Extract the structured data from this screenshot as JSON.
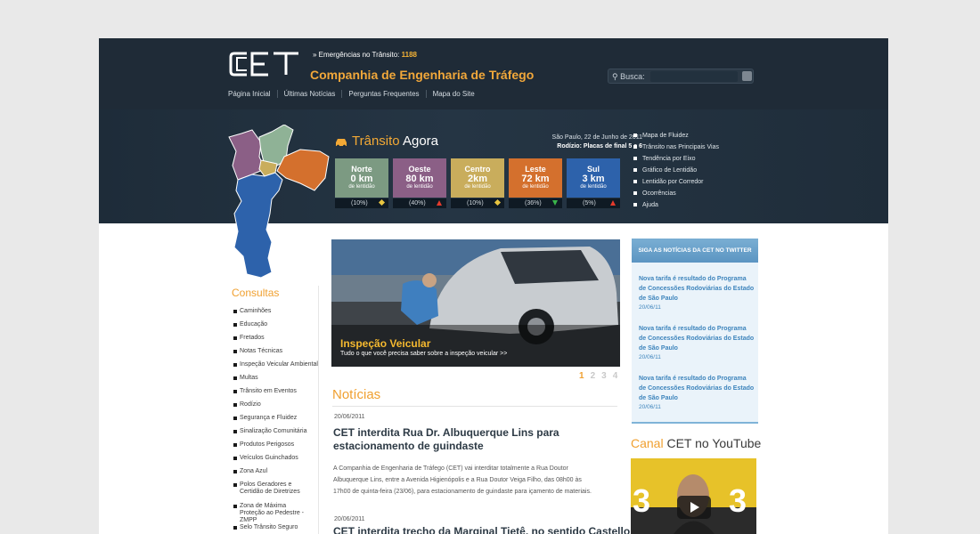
{
  "header": {
    "logo_text": "CET",
    "emergency_label": "Emergências no Trânsito:",
    "emergency_number": "1188",
    "company_name": "Companhia de Engenharia de Tráfego",
    "nav": [
      "Página Inicial",
      "Últimas Notícias",
      "Perguntas Frequentes",
      "Mapa do Site"
    ],
    "search_label": "Busca:",
    "search_value": ""
  },
  "traffic": {
    "title_part1": "Trânsito",
    "title_part2": "Agora",
    "date": "São Paulo, 22 de Junho de 2011",
    "rodizio": "Rodízio: Placas de final 5 e 6",
    "zones": [
      {
        "name": "Norte",
        "km": "0 km",
        "sub": "de lentidão",
        "pct": "(10%)",
        "trend": "stable",
        "color": "#7c9a82"
      },
      {
        "name": "Oeste",
        "km": "80 km",
        "sub": "de lentidão",
        "pct": "(40%)",
        "trend": "up",
        "color": "#8b5f86"
      },
      {
        "name": "Centro",
        "km": "2km",
        "sub": "de lentidão",
        "pct": "(10%)",
        "trend": "stable",
        "color": "#c9ad5c"
      },
      {
        "name": "Leste",
        "km": "72 km",
        "sub": "de lentidão",
        "pct": "(36%)",
        "trend": "down",
        "color": "#d4702d"
      },
      {
        "name": "Sul",
        "km": "3 km",
        "sub": "de lentidão",
        "pct": "(5%)",
        "trend": "up",
        "color": "#2d62ab"
      }
    ],
    "links": [
      "Mapa de Fluidez",
      "Trânsito nas Principais Vias",
      "Tendência por Eixo",
      "Gráfico de Lentidão",
      "Lentidão por Corredor",
      "Ocorrências",
      "Ajuda"
    ]
  },
  "consultas": {
    "title": "Consultas",
    "items": [
      "Caminhões",
      "Educação",
      "Fretados",
      "Notas Técnicas",
      "Inspeção Veicular Ambiental",
      "Multas",
      "Trânsito em Eventos",
      "Rodízio",
      "Segurança e Fluidez",
      "Sinalização Comunitária",
      "Produtos Perigosos",
      "Veículos Guinchados",
      "Zona Azul",
      "Polos Geradores e Certidão de Diretrizes",
      "Zona de Máxima Proteção ao Pedestre - ZMPP",
      "Selo Trânsito Seguro"
    ]
  },
  "slide": {
    "title": "Inspeção Veicular",
    "subtitle": "Tudo o que você precisa saber sobre a inspeção veicular >>",
    "pages": [
      "1",
      "2",
      "3",
      "4"
    ],
    "active_page": "1"
  },
  "news": {
    "title": "Notícias",
    "items": [
      {
        "date": "20/06/2011",
        "title": "CET interdita Rua Dr. Albuquerque Lins para estacionamento de guindaste",
        "body": "A Companhia de Engenharia de Tráfego (CET) vai interditar totalmente a Rua Doutor Albuquerque Lins, entre a Avenida Higienópolis e a Rua Doutor Veiga Filho, das 08h00 às 17h00 de quinta-feira (23/06), para estacionamento de guindaste para içamento de materiais."
      },
      {
        "date": "20/06/2011",
        "title": "CET interdita trecho da Marginal Tietê, no sentido Castello",
        "body": ""
      }
    ]
  },
  "twitter": {
    "header": "SIGA AS NOTÍCIAS DA CET NO TWITTER",
    "items": [
      {
        "text": "Nova tarifa é resultado do Programa de Concessões Rodoviárias do Estado de São Paulo",
        "date": "20/06/11"
      },
      {
        "text": "Nova tarifa é resultado do Programa de Concessões Rodoviárias do Estado de São Paulo",
        "date": "20/06/11"
      },
      {
        "text": "Nova tarifa é resultado do Programa de Concessões Rodoviárias do Estado de São Paulo",
        "date": "20/06/11"
      }
    ]
  },
  "youtube": {
    "title_hl": "Canal",
    "title_rest": "CET no YouTube"
  }
}
